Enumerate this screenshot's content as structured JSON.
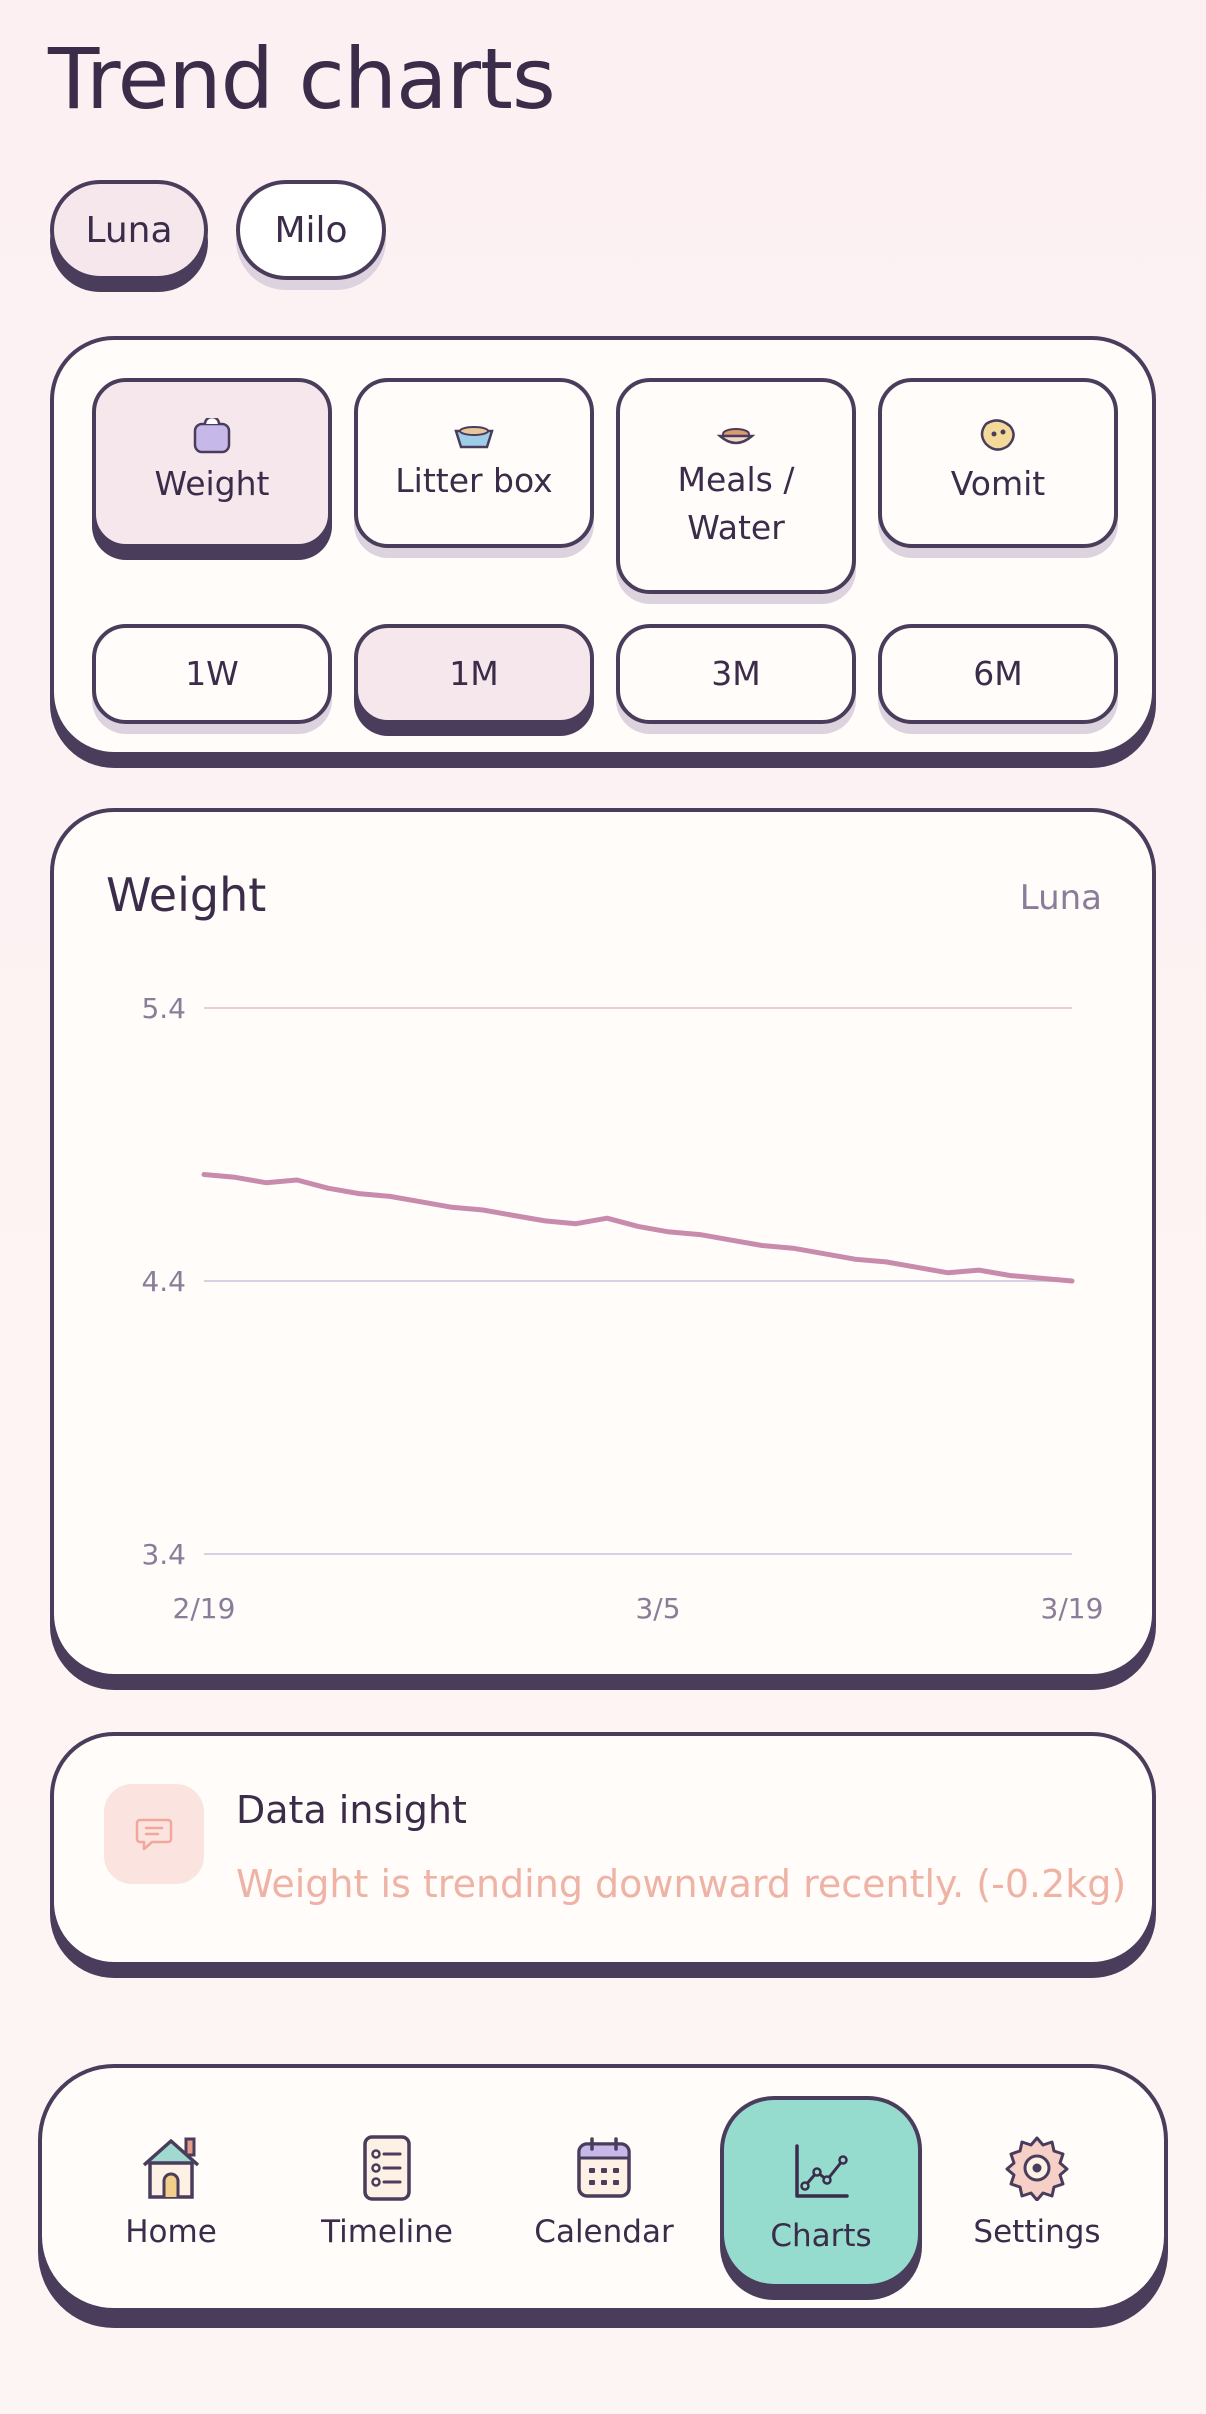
{
  "page": {
    "title": "Trend charts"
  },
  "pets": [
    {
      "name": "Luna",
      "selected": true
    },
    {
      "name": "Milo",
      "selected": false
    }
  ],
  "metrics": [
    {
      "label": "Weight",
      "icon": "scale-icon",
      "selected": true
    },
    {
      "label": "Litter box",
      "icon": "litter-box-icon",
      "selected": false
    },
    {
      "label": "Meals / Water",
      "label_line1": "Meals /",
      "label_line2": "Water",
      "icon": "food-bowl-icon",
      "selected": false
    },
    {
      "label": "Vomit",
      "icon": "vomit-icon",
      "selected": false
    }
  ],
  "ranges": [
    {
      "label": "1W",
      "selected": false
    },
    {
      "label": "1M",
      "selected": true
    },
    {
      "label": "3M",
      "selected": false
    },
    {
      "label": "6M",
      "selected": false
    }
  ],
  "chart": {
    "title": "Weight",
    "pet": "Luna"
  },
  "chart_data": {
    "type": "line",
    "title": "Weight",
    "xlabel": "",
    "ylabel": "",
    "y_ticks": [
      "5.4",
      "4.4",
      "3.4"
    ],
    "x_ticks": [
      "2/19",
      "3/5",
      "3/19"
    ],
    "ylim": [
      3.4,
      5.4
    ],
    "grid": true,
    "series": [
      {
        "color": "#c98bab",
        "x": [
          "2/19",
          "2/20",
          "2/21",
          "2/22",
          "2/23",
          "2/24",
          "2/25",
          "2/26",
          "2/27",
          "2/28",
          "3/1",
          "3/2",
          "3/3",
          "3/4",
          "3/5",
          "3/6",
          "3/7",
          "3/8",
          "3/9",
          "3/10",
          "3/11",
          "3/12",
          "3/13",
          "3/14",
          "3/15",
          "3/16",
          "3/17",
          "3/18",
          "3/19"
        ],
        "values": [
          4.79,
          4.78,
          4.76,
          4.77,
          4.74,
          4.72,
          4.71,
          4.69,
          4.67,
          4.66,
          4.64,
          4.62,
          4.61,
          4.63,
          4.6,
          4.58,
          4.57,
          4.55,
          4.53,
          4.52,
          4.5,
          4.48,
          4.47,
          4.45,
          4.43,
          4.44,
          4.42,
          4.41,
          4.4
        ]
      }
    ]
  },
  "insight": {
    "title": "Data insight",
    "text": "Weight is trending downward recently. (-0.2kg)",
    "icon": "chat-bubble-icon"
  },
  "nav": [
    {
      "label": "Home",
      "icon": "home-icon",
      "active": false
    },
    {
      "label": "Timeline",
      "icon": "timeline-icon",
      "active": false
    },
    {
      "label": "Calendar",
      "icon": "calendar-icon",
      "active": false
    },
    {
      "label": "Charts",
      "icon": "chart-icon",
      "active": true
    },
    {
      "label": "Settings",
      "icon": "settings-icon",
      "active": false
    }
  ],
  "colors": {
    "outline": "#4a3d5c",
    "selected_fill": "#f6e7ec",
    "accent_teal": "#95dccf",
    "line": "#c98bab",
    "insight_text": "#efb3a6"
  }
}
